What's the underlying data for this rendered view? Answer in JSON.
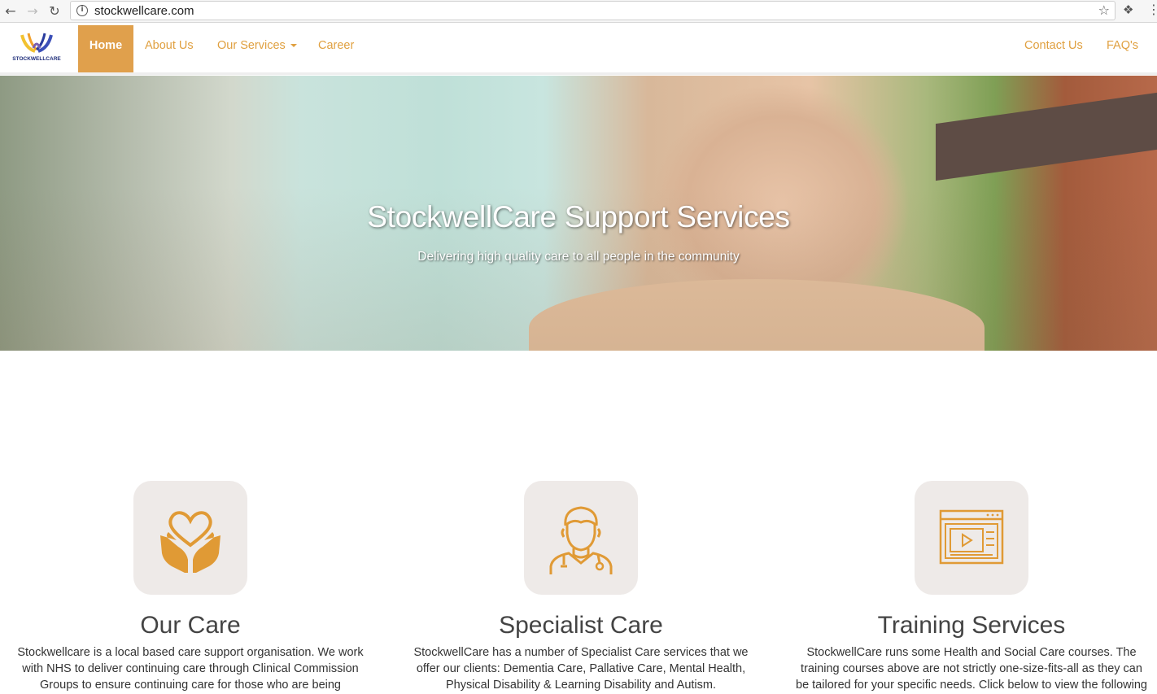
{
  "browser": {
    "url": "stockwellcare.com",
    "back_icon": "back-arrow-icon",
    "forward_icon": "forward-arrow-icon",
    "reload_icon": "reload-icon",
    "info_icon": "info-icon",
    "bookmark_icon": "star-icon",
    "extension_icon": "puzzle-icon",
    "menu_icon": "kebab-menu-icon"
  },
  "navbar": {
    "logo_text": "STOCKWELLCARE",
    "items": [
      {
        "label": "Home",
        "active": true
      },
      {
        "label": "About Us"
      },
      {
        "label": "Our Services",
        "dropdown": true
      },
      {
        "label": "Career"
      }
    ],
    "right_items": [
      {
        "label": "Contact Us"
      },
      {
        "label": "FAQ's"
      }
    ]
  },
  "hero": {
    "title": "StockwellCare Support Services",
    "subtitle": "Delivering high quality care to all people in the community"
  },
  "features": [
    {
      "icon": "hands-heart-icon",
      "title": "Our Care",
      "text": "Stockwellcare is a local based care support organisation. We work with NHS to deliver continuing care through Clinical Commission Groups to ensure continuing care for those who are being"
    },
    {
      "icon": "doctor-icon",
      "title": "Specialist Care",
      "text": "StockwellCare has a number of Specialist Care services that we offer our clients: Dementia Care, Pallative Care, Mental Health, Physical Disability & Learning Disability and Autism."
    },
    {
      "icon": "video-browser-icon",
      "title": "Training Services",
      "text": "StockwellCare runs some Health and Social Care courses. The training courses above are not strictly one-size-fits-all as they can be tailored for your specific needs. Click below to view the following"
    }
  ],
  "colors": {
    "accent": "#e0a04c",
    "icon_bg": "#eeeae8"
  }
}
